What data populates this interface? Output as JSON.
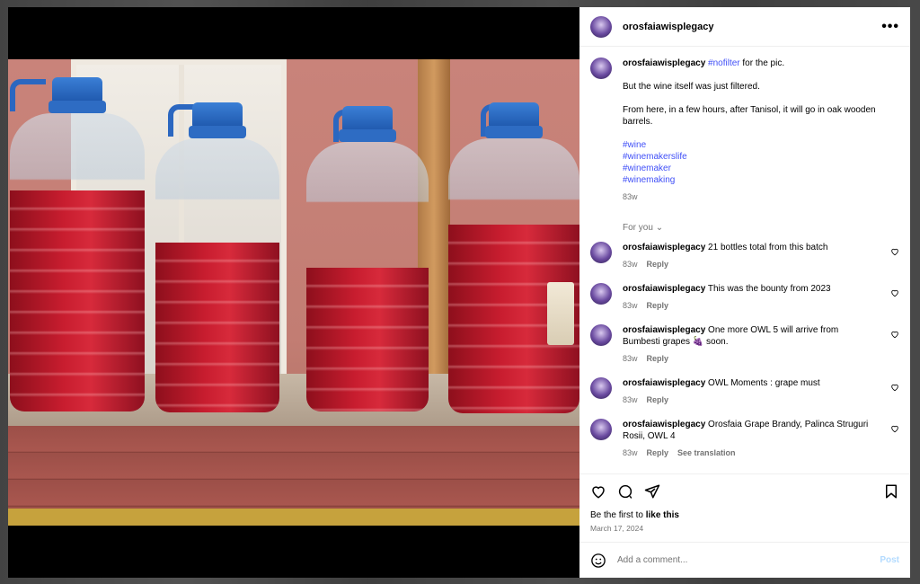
{
  "post": {
    "username": "orosfaiawisplegacy",
    "more_icon": "more-horizontal-icon"
  },
  "caption": {
    "username": "orosfaiawisplegacy",
    "tag": "#nofilter",
    "line1_rest": " for the pic.",
    "line2": "But the wine itself was just filtered.",
    "line3": "From here, in a few hours, after Tanisol, it will go in oak wooden barrels.",
    "hashtags": [
      "#wine",
      "#winemakerslife",
      "#winemaker",
      "#winemaking"
    ],
    "time": "83w"
  },
  "for_you": "For you",
  "comments": [
    {
      "username": "orosfaiawisplegacy",
      "text": "21 bottles total from this batch",
      "time": "83w",
      "reply": "Reply",
      "extra": ""
    },
    {
      "username": "orosfaiawisplegacy",
      "text": "This was the bounty from 2023",
      "time": "83w",
      "reply": "Reply",
      "extra": ""
    },
    {
      "username": "orosfaiawisplegacy",
      "text": "One more OWL 5 will arrive from Bumbesti grapes 🍇 soon.",
      "time": "83w",
      "reply": "Reply",
      "extra": ""
    },
    {
      "username": "orosfaiawisplegacy",
      "text": "OWL Moments : grape must",
      "time": "83w",
      "reply": "Reply",
      "extra": ""
    },
    {
      "username": "orosfaiawisplegacy",
      "text": "Orosfaia Grape Brandy, Palinca Struguri Rosii, OWL 4",
      "time": "83w",
      "reply": "Reply",
      "extra": "See translation"
    }
  ],
  "likes": {
    "prefix": "Be the first to ",
    "action": "like this"
  },
  "date": "March 17, 2024",
  "comment_box": {
    "placeholder": "Add a comment...",
    "post_label": "Post"
  },
  "colors": {
    "link": "#4150f7",
    "muted": "#737373",
    "post_disabled": "#b3dbff",
    "wine": "#c81d2f",
    "cap": "#2e6cc3"
  }
}
